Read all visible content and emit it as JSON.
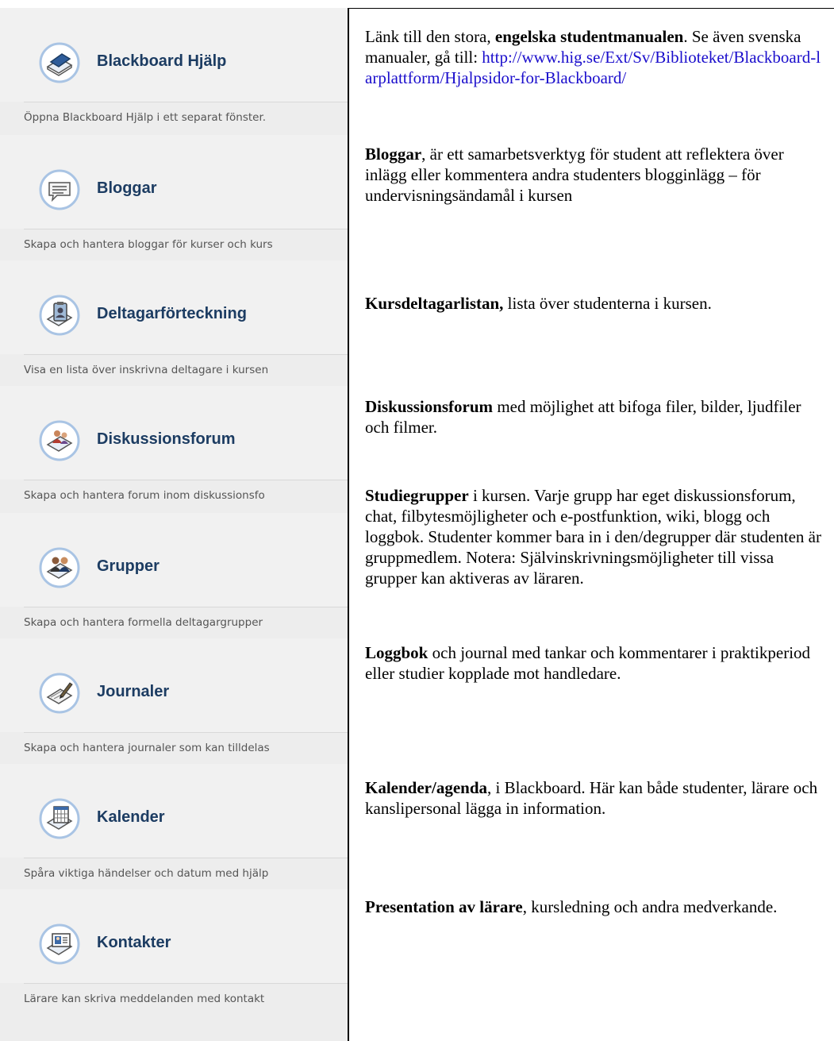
{
  "colors": {
    "tool_title": "#1c3c62",
    "link": "#1a0dcc",
    "panel_bg": "#ededed"
  },
  "tools": [
    {
      "title": "Blackboard Hjälp",
      "description": "Öppna Blackboard Hjälp i ett separat fönster.",
      "icon": "help-book-icon"
    },
    {
      "title": "Bloggar",
      "description": "Skapa och hantera bloggar för kurser och kurs",
      "icon": "speech-bubble-icon"
    },
    {
      "title": "Deltagarförteckning",
      "description": "Visa en lista över inskrivna deltagare i kursen",
      "icon": "clipboard-roster-icon"
    },
    {
      "title": "Diskussionsforum",
      "description": "Skapa och hantera forum inom diskussionsfo",
      "icon": "discussion-people-icon"
    },
    {
      "title": "Grupper",
      "description": "Skapa och hantera formella deltagargrupper",
      "icon": "group-people-icon"
    },
    {
      "title": "Journaler",
      "description": "Skapa och hantera journaler som kan tilldelas",
      "icon": "journal-pen-icon"
    },
    {
      "title": "Kalender",
      "description": "Spåra viktiga händelser och datum med hjälp",
      "icon": "calendar-icon"
    },
    {
      "title": "Kontakter",
      "description": "Lärare kan skriva meddelanden med kontakt",
      "icon": "contact-card-icon"
    }
  ],
  "notes": {
    "n1_prefix": "Länk till den stora, ",
    "n1_bold": "engelska studentmanualen",
    "n1_suffix": ". Se även svenska manualer, gå till: ",
    "n1_link": "http://www.hig.se/Ext/Sv/Biblioteket/Blackboard-larplattform/Hjalpsidor-for-Blackboard/",
    "n2_bold": "Bloggar",
    "n2_text": ", är ett samarbetsverktyg för student att reflektera över inlägg eller kommentera andra studenters blogginlägg – för undervisningsändamål i kursen",
    "n3_bold": "Kursdeltagarlistan,",
    "n3_text": " lista över studenterna i kursen.",
    "n4_bold": "Diskussionsforum",
    "n4_text": " med möjlighet att bifoga filer, bilder, ljudfiler och filmer.",
    "n5_bold": "Studiegrupper",
    "n5_text": " i kursen. Varje grupp har eget diskussionsforum, chat, filbytesmöjligheter och e-postfunktion, wiki, blogg och loggbok. Studenter kommer bara in i den/degrupper där studenten är gruppmedlem. Notera: Självinskrivningsmöjligheter till vissa grupper kan aktiveras av läraren.",
    "n6_bold": "Loggbok",
    "n6_text": " och journal med tankar och kommentarer i praktikperiod eller studier kopplade mot handledare.",
    "n7_bold": "Kalender/agenda",
    "n7_text": ", i Blackboard. Här kan både studenter, lärare och kanslipersonal lägga in information.",
    "n8_bold": "Presentation av lärare",
    "n8_text": ", kursledning och andra medverkande."
  }
}
